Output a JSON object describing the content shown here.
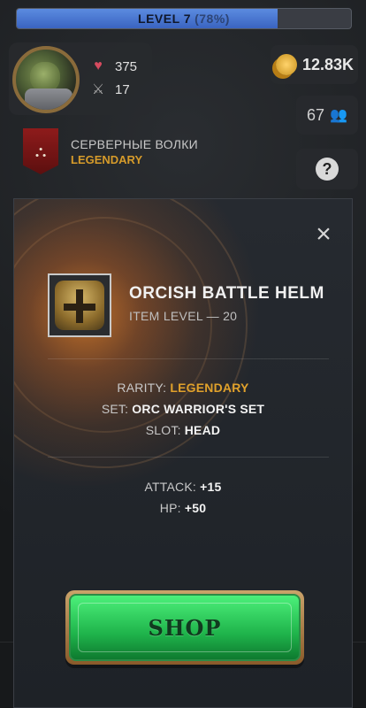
{
  "top_bar": {
    "level_label": "LEVEL 7",
    "level_percent_text": "(78%)",
    "level_progress_fraction": 0.78
  },
  "player": {
    "hp_value": "375",
    "attack_value": "17",
    "icons": {
      "hp": "heart-icon",
      "attack": "crossed-swords-icon"
    }
  },
  "currency": {
    "gold_value": "12.83K",
    "gold_icon": "gold-coins-icon"
  },
  "social": {
    "friends_count": "67",
    "friends_icon": "friends-icon",
    "help_icon": "help-icon"
  },
  "guild": {
    "name": "СЕРВЕРНЫЕ ВОЛКИ",
    "rank": "LEGENDARY",
    "banner_icon": "guild-banner-icon"
  },
  "modal": {
    "item_title": "ORCISH BATTLE HELM",
    "item_level": "ITEM LEVEL — 20",
    "rarity_label": "RARITY:",
    "rarity_value": "LEGENDARY",
    "set_label": "SET:",
    "set_value": "ORC WARRIOR'S SET",
    "slot_label": "SLOT:",
    "slot_value": "HEAD",
    "attack_label": "ATTACK:",
    "attack_value": "+15",
    "hp_label": "HP:",
    "hp_value": "+50",
    "shop_button_label": "SHOP",
    "close_icon": "close-icon"
  },
  "colors": {
    "legendary": "#e0a12b",
    "button_green": "#1fb44b",
    "level_fill": "#4a79d6"
  }
}
